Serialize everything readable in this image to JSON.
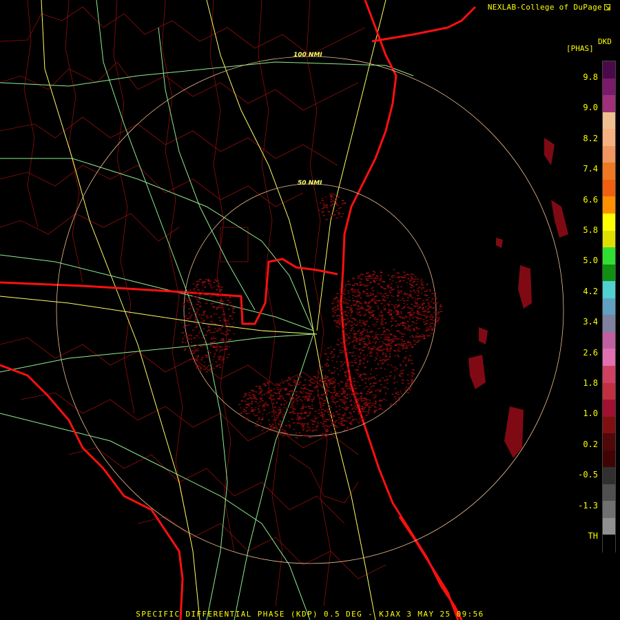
{
  "header": {
    "credit": "NEXLAB-College of DuPage",
    "credit_icon": "external-link-arrow-icon"
  },
  "product": {
    "code": "DKD",
    "unit": "[PHAS]"
  },
  "scale": {
    "labels": [
      "9.8",
      "9.0",
      "8.2",
      "7.4",
      "6.6",
      "5.8",
      "5.0",
      "4.2",
      "3.4",
      "2.6",
      "1.8",
      "1.0",
      "0.2",
      "-0.5",
      "-1.3",
      "TH"
    ],
    "colors": [
      "#4a0a4a",
      "#7a1a6a",
      "#a0307a",
      "#f0c090",
      "#f7b080",
      "#f09860",
      "#f07820",
      "#f06010",
      "#ff9000",
      "#ffff00",
      "#e0e000",
      "#30e030",
      "#109010",
      "#50d0d0",
      "#60a0c0",
      "#8080a0",
      "#c060a0",
      "#e070b0",
      "#d04060",
      "#c03040",
      "#a01030",
      "#801010",
      "#500808",
      "#400404",
      "#303030",
      "#505050",
      "#707070",
      "#909090",
      "#000000"
    ]
  },
  "rings": {
    "inner_label": "50 NMI",
    "outer_label": "100 NMI"
  },
  "footer": {
    "text": "SPECIFIC DIFFERENTIAL PHASE (KDP) 0.5 DEG - KJAX 3 MAY 25 09:56"
  }
}
